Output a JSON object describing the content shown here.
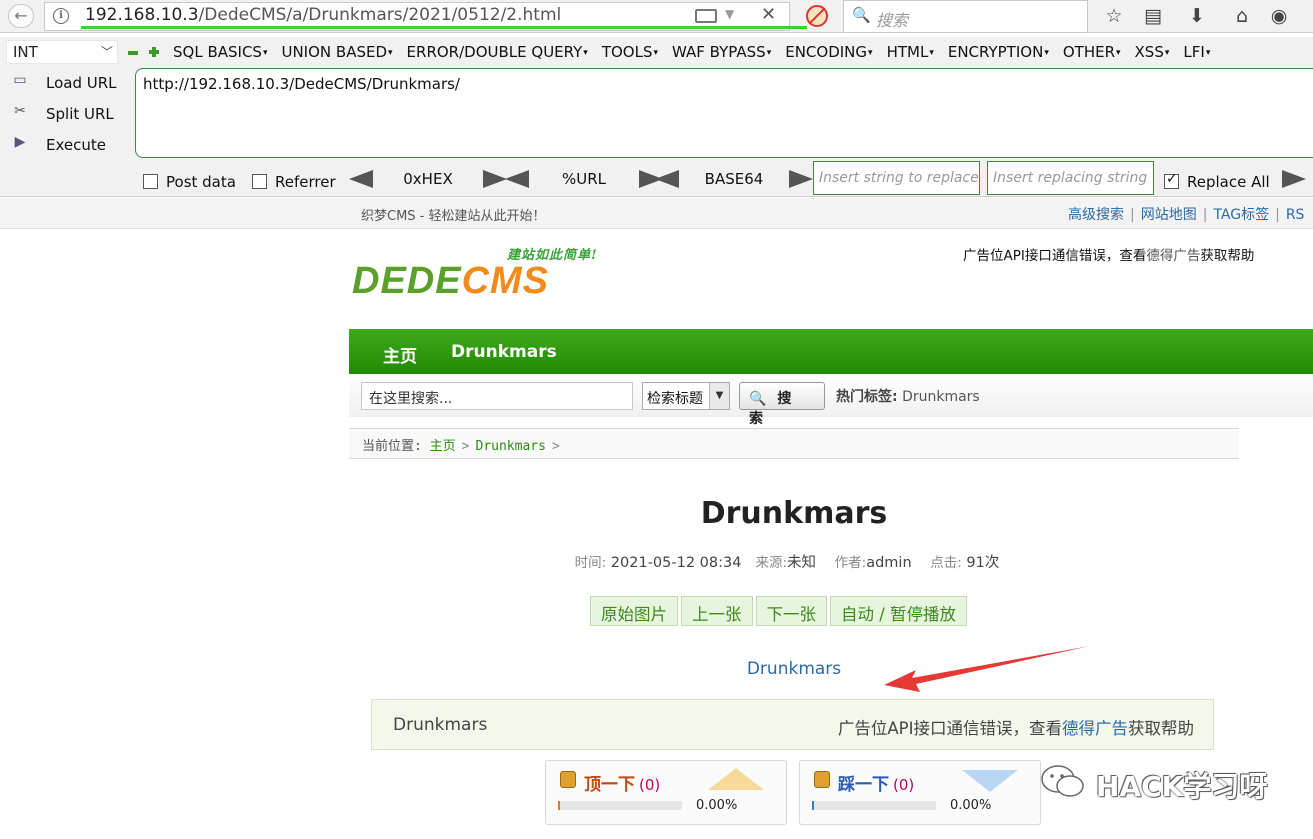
{
  "browser": {
    "url_host": "192.168.10.3",
    "url_path": "/DedeCMS/a/Drunkmars/2021/0512/2.html",
    "search_placeholder": "搜索"
  },
  "hackbar": {
    "int_select": "INT",
    "menus": [
      "SQL BASICS",
      "UNION BASED",
      "ERROR/DOUBLE QUERY",
      "TOOLS",
      "WAF BYPASS",
      "ENCODING",
      "HTML",
      "ENCRYPTION",
      "OTHER",
      "XSS",
      "LFI"
    ],
    "load_url": "Load URL",
    "split_url": "Split URL",
    "execute": "Execute",
    "textarea_value": "http://192.168.10.3/DedeCMS/Drunkmars/",
    "post_data": "Post data",
    "referrer": "Referrer",
    "hex": "0xHEX",
    "url_enc": "%URL",
    "base64": "BASE64",
    "replace_placeholder": "Insert string to replace",
    "replacing_placeholder": "Insert replacing string",
    "replace_all": "Replace All"
  },
  "site": {
    "welcome": "织梦CMS - 轻松建站从此开始！",
    "top_links": [
      "高级搜索",
      "网站地图",
      "TAG标签",
      "RS"
    ],
    "logo_slogan": "建站如此简单!",
    "logo_dede": "DEDE",
    "logo_cms": "CMS",
    "ad_top_prefix": "广告位API接口通信错误，查看",
    "ad_top_link": "德得广告",
    "ad_top_suffix": "获取帮助",
    "nav": [
      "主页",
      "Drunkmars"
    ],
    "search_value": "在这里搜索...",
    "search_select": "检索标题",
    "search_button": "搜 索",
    "hot_tags_label": "热门标签:",
    "hot_tag": "Drunkmars",
    "breadcrumb_label": "当前位置:",
    "breadcrumb_items": [
      "主页",
      "Drunkmars"
    ]
  },
  "article": {
    "title": "Drunkmars",
    "time_label": "时间:",
    "time": "2021-05-12 08:34",
    "source_label": "来源:",
    "source": "未知",
    "author_label": "作者:",
    "author": "admin",
    "clicks_label": "点击:",
    "clicks": "91次",
    "pic_buttons": [
      "原始图片",
      "上一张",
      "下一张",
      "自动 / 暂停播放"
    ],
    "pic_name": "Drunkmars",
    "ad_name": "Drunkmars",
    "ad_prefix": "广告位API接口通信错误，查看",
    "ad_link": "德得广告",
    "ad_suffix": "获取帮助"
  },
  "votes": {
    "up_label": "顶一下",
    "up_count": "(0)",
    "up_pct": "0.00%",
    "down_label": "踩一下",
    "down_count": "(0)",
    "down_pct": "0.00%"
  },
  "watermark": "HACK学习呀",
  "colors": {
    "nav_green": "#2a9a0c",
    "link_blue": "#2a6aa8",
    "annotation_red": "#e53935"
  }
}
